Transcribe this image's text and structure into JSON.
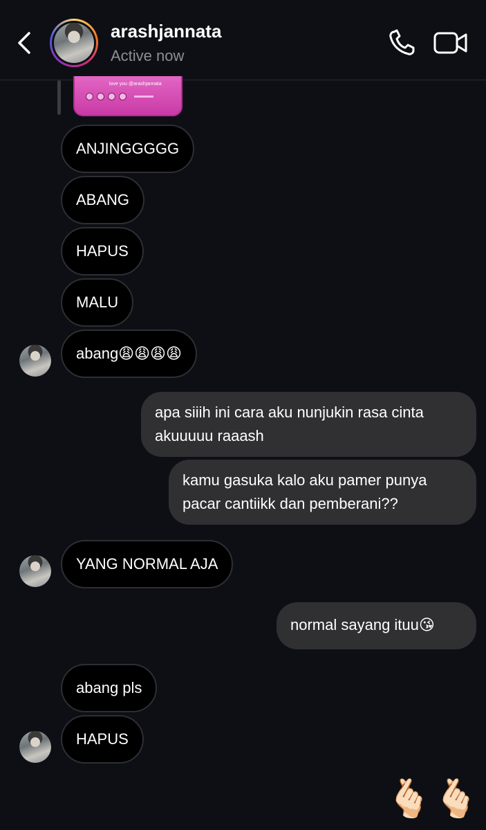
{
  "header": {
    "username": "arashjannata",
    "status": "Active now"
  },
  "post_preview": {
    "caption": "love you @arashjannata"
  },
  "messages": [
    {
      "text": "ANJINGGGGG"
    },
    {
      "text": "ABANG"
    },
    {
      "text": "HAPUS"
    },
    {
      "text": "MALU"
    },
    {
      "text": "abang😩😩😩😩"
    },
    {
      "text": "apa siiih ini cara aku nunjukin rasa cinta akuuuuu raaash"
    },
    {
      "text": "kamu gasuka kalo aku pamer punya pacar cantiikk dan pemberani??"
    },
    {
      "text": "YANG NORMAL AJA"
    },
    {
      "text": "normal sayang ituu😘"
    },
    {
      "text": "abang pls"
    },
    {
      "text": "HAPUS"
    }
  ],
  "reactions": [
    "🫰🏻",
    "🫰🏻"
  ],
  "colors": {
    "background": "#0d0f14",
    "incoming_bubble": "#000000",
    "outgoing_bubble": "#303033",
    "status_text": "#8e8e93"
  },
  "icons": {
    "back": "chevron-left-icon",
    "call": "phone-icon",
    "video": "video-camera-icon"
  }
}
